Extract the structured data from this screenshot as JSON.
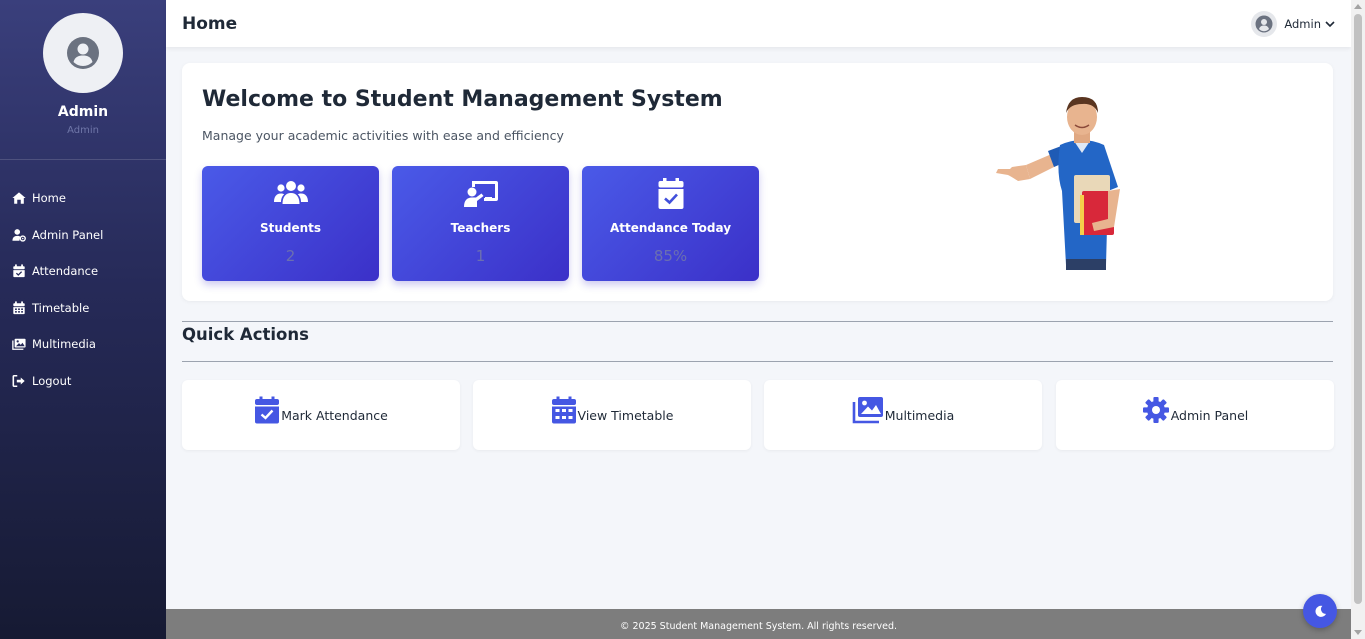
{
  "sidebar": {
    "user_name": "Admin",
    "user_role": "Admin",
    "items": [
      {
        "label": "Home",
        "icon": "home-icon"
      },
      {
        "label": "Admin Panel",
        "icon": "user-gear-icon"
      },
      {
        "label": "Attendance",
        "icon": "calendar-check-icon"
      },
      {
        "label": "Timetable",
        "icon": "calendar-grid-icon"
      },
      {
        "label": "Multimedia",
        "icon": "images-icon"
      },
      {
        "label": "Logout",
        "icon": "logout-icon"
      }
    ]
  },
  "header": {
    "title": "Home",
    "user_label": "Admin"
  },
  "hero": {
    "title": "Welcome to Student Management System",
    "subtitle": "Manage your academic activities with ease and efficiency",
    "stats": [
      {
        "label": "Students",
        "value": "2",
        "icon": "users-icon"
      },
      {
        "label": "Teachers",
        "value": "1",
        "icon": "chalkboard-teacher-icon"
      },
      {
        "label": "Attendance Today",
        "value": "85%",
        "icon": "calendar-check-icon"
      }
    ]
  },
  "quick_actions": {
    "title": "Quick Actions",
    "items": [
      {
        "label": "Mark Attendance",
        "icon": "calendar-check-icon"
      },
      {
        "label": "View Timetable",
        "icon": "calendar-grid-icon"
      },
      {
        "label": "Multimedia",
        "icon": "images-icon"
      },
      {
        "label": "Admin Panel",
        "icon": "gear-icon"
      }
    ]
  },
  "footer": {
    "text": "© 2025 Student Management System. All rights reserved."
  },
  "colors": {
    "accent": "#4557e3",
    "sidebar_top": "#3a3f7c",
    "sidebar_bottom": "#161a33",
    "footer": "#7d7d7d"
  }
}
